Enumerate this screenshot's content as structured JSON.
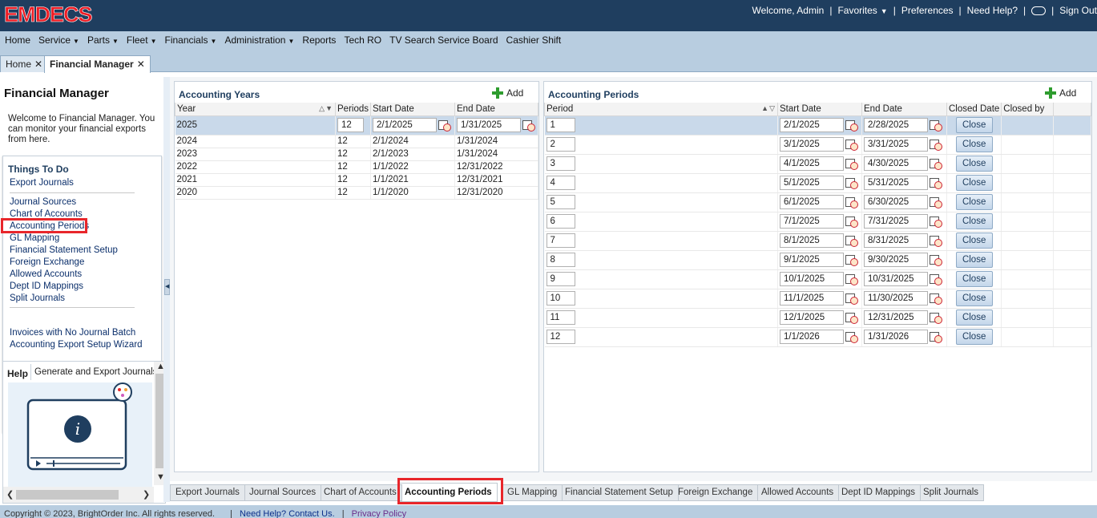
{
  "header": {
    "logo_text": "EMDECS",
    "welcome": "Welcome, Admin",
    "favorites": "Favorites",
    "preferences": "Preferences",
    "need_help": "Need Help?",
    "sign_out": "Sign Out"
  },
  "nav": [
    {
      "label": "Home",
      "dropdown": false
    },
    {
      "label": "Service",
      "dropdown": true
    },
    {
      "label": "Parts",
      "dropdown": true
    },
    {
      "label": "Fleet",
      "dropdown": true
    },
    {
      "label": "Financials",
      "dropdown": true
    },
    {
      "label": "Administration",
      "dropdown": true
    },
    {
      "label": "Reports",
      "dropdown": false
    },
    {
      "label": "Tech RO",
      "dropdown": false
    },
    {
      "label": "TV Search Service Board",
      "dropdown": false
    },
    {
      "label": "Cashier Shift",
      "dropdown": false
    }
  ],
  "doc_tabs": [
    {
      "label": "Home",
      "active": false
    },
    {
      "label": "Financial Manager",
      "active": true
    }
  ],
  "left_panel": {
    "title": "Financial Manager",
    "welcome": "Welcome to Financial Manager. You can monitor your financial exports from here.",
    "things_to_do_title": "Things To Do",
    "links_group1": [
      "Export Journals"
    ],
    "links_group2": [
      "Journal Sources",
      "Chart of Accounts",
      "Accounting Periods",
      "GL Mapping",
      "Financial Statement Setup",
      "Foreign Exchange",
      "Allowed Accounts",
      "Dept ID Mappings",
      "Split Journals"
    ],
    "links_group3": [
      "Invoices with No Journal Batch",
      "Accounting Export Setup Wizard"
    ],
    "highlighted_link": "Accounting Periods",
    "help_label": "Help",
    "help_topic": "Generate and Export Journals"
  },
  "years_panel": {
    "title": "Accounting Years",
    "add_label": "Add",
    "columns": [
      "Year",
      "Periods",
      "Start Date",
      "End Date"
    ],
    "rows": [
      {
        "year": "2025",
        "periods": "12",
        "start": "2/1/2025",
        "end": "1/31/2025"
      },
      {
        "year": "2024",
        "periods": "12",
        "start": "2/1/2024",
        "end": "1/31/2024"
      },
      {
        "year": "2023",
        "periods": "12",
        "start": "2/1/2023",
        "end": "1/31/2024"
      },
      {
        "year": "2022",
        "periods": "12",
        "start": "1/1/2022",
        "end": "12/31/2022"
      },
      {
        "year": "2021",
        "periods": "12",
        "start": "1/1/2021",
        "end": "12/31/2021"
      },
      {
        "year": "2020",
        "periods": "12",
        "start": "1/1/2020",
        "end": "12/31/2020"
      }
    ]
  },
  "periods_panel": {
    "title": "Accounting Periods",
    "add_label": "Add",
    "columns": [
      "Period",
      "Start Date",
      "End Date",
      "Closed Date",
      "Closed by"
    ],
    "close_label": "Close",
    "rows": [
      {
        "period": "1",
        "start": "2/1/2025",
        "end": "2/28/2025"
      },
      {
        "period": "2",
        "start": "3/1/2025",
        "end": "3/31/2025"
      },
      {
        "period": "3",
        "start": "4/1/2025",
        "end": "4/30/2025"
      },
      {
        "period": "4",
        "start": "5/1/2025",
        "end": "5/31/2025"
      },
      {
        "period": "5",
        "start": "6/1/2025",
        "end": "6/30/2025"
      },
      {
        "period": "6",
        "start": "7/1/2025",
        "end": "7/31/2025"
      },
      {
        "period": "7",
        "start": "8/1/2025",
        "end": "8/31/2025"
      },
      {
        "period": "8",
        "start": "9/1/2025",
        "end": "9/30/2025"
      },
      {
        "period": "9",
        "start": "10/1/2025",
        "end": "10/31/2025"
      },
      {
        "period": "10",
        "start": "11/1/2025",
        "end": "11/30/2025"
      },
      {
        "period": "11",
        "start": "12/1/2025",
        "end": "12/31/2025"
      },
      {
        "period": "12",
        "start": "1/1/2026",
        "end": "1/31/2026"
      }
    ]
  },
  "bottom_tabs": [
    {
      "label": "Export Journals",
      "active": false
    },
    {
      "label": "Journal Sources",
      "active": false
    },
    {
      "label": "Chart of Accounts",
      "active": false
    },
    {
      "label": "Accounting Periods",
      "active": true
    },
    {
      "label": "GL Mapping",
      "active": false
    },
    {
      "label": "Financial Statement Setup",
      "active": false
    },
    {
      "label": "Foreign Exchange",
      "active": false
    },
    {
      "label": "Allowed Accounts",
      "active": false
    },
    {
      "label": "Dept ID Mappings",
      "active": false
    },
    {
      "label": "Split Journals",
      "active": false
    }
  ],
  "footer": {
    "copyright": "Copyright © 2023, BrightOrder Inc. All rights reserved.",
    "help_link": "Need Help? Contact Us.",
    "privacy_link": "Privacy Policy"
  },
  "colors": {
    "header_bg": "#1f3e5f",
    "nav_bg": "#b8cde0",
    "logo_red": "#ee1c24",
    "highlight_red": "#e8262b",
    "selected_row": "#c9d9ea"
  },
  "icons": [
    "calendar-clock-icon",
    "plus-icon",
    "sort-asc-icon",
    "sort-desc-icon",
    "chevron-down-icon",
    "chat-icon",
    "info-video-icon"
  ]
}
